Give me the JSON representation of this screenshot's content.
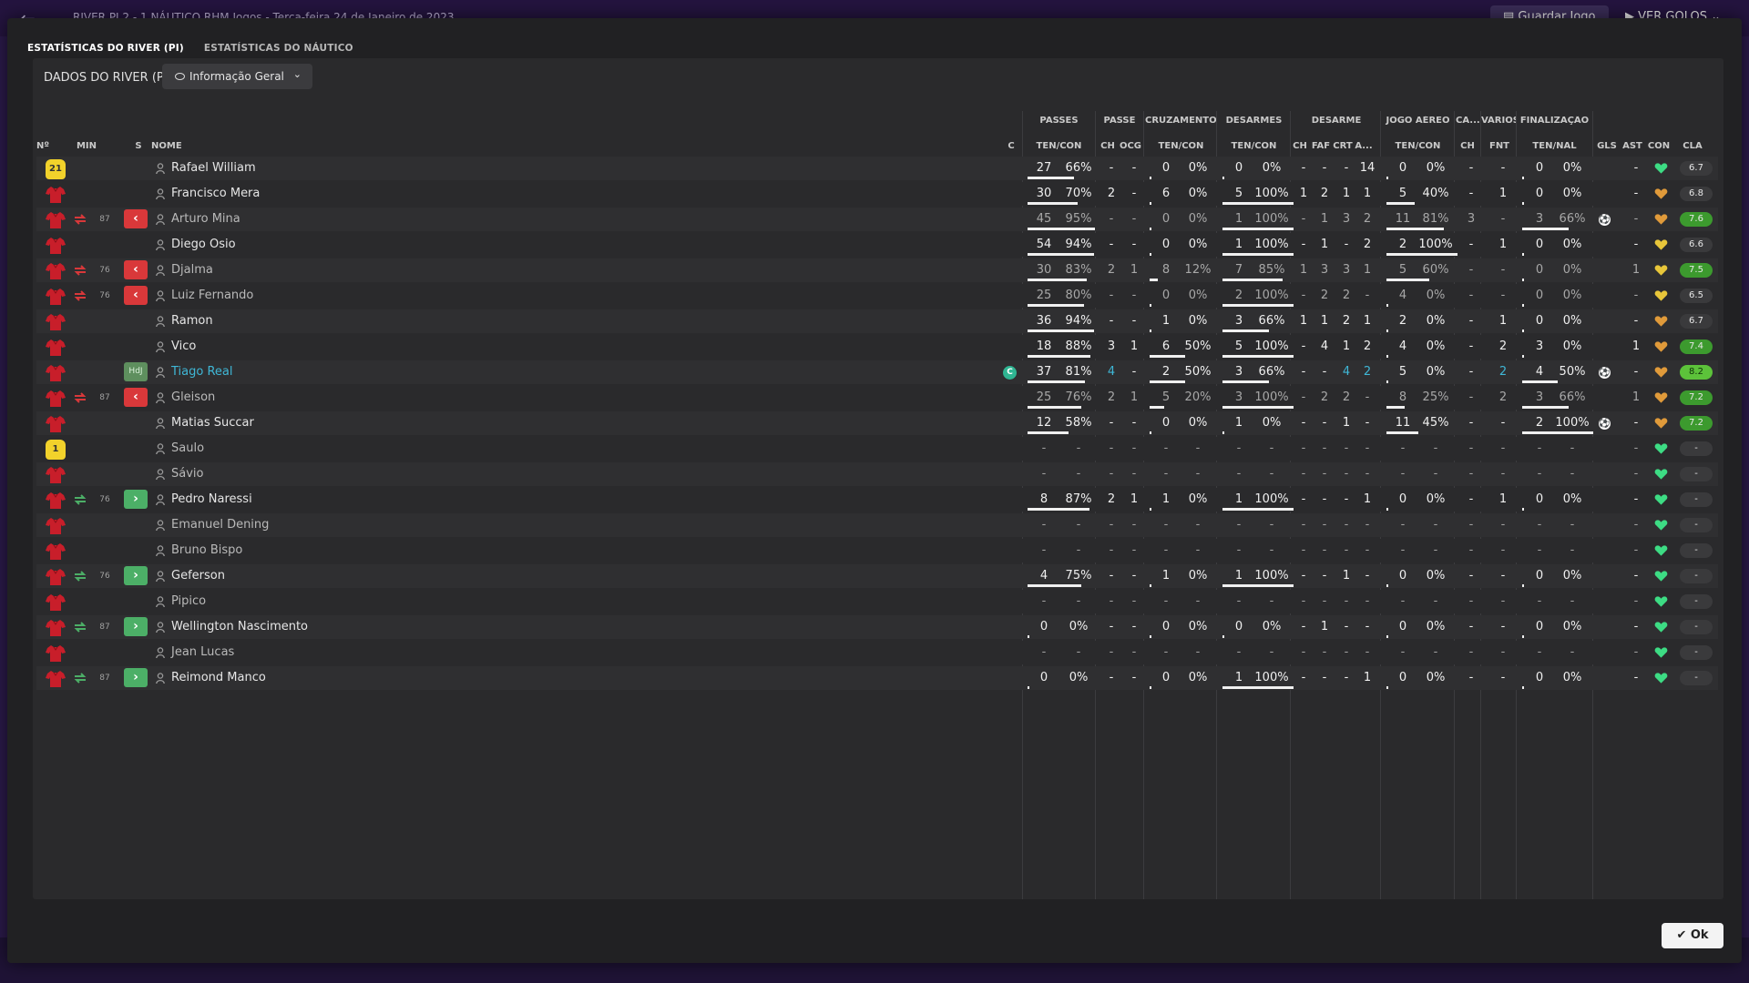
{
  "window": {
    "title": "RIVER PI 2 - 1 NÁUTICO  RHM Jogos  -  Terça-feira 24 de Janeiro de 2023",
    "save_label": "Guardar Jogo",
    "goals_label": "VER GOLOS"
  },
  "tabs": [
    {
      "label": "ESTATÍSTICAS DO RIVER (PI)",
      "active": true
    },
    {
      "label": "ESTATÍSTICAS DO NÁUTICO",
      "active": false
    }
  ],
  "toolbar": {
    "data_label": "DADOS DO RIVER (PI)",
    "view_select": "Informação Geral"
  },
  "groups": [
    "PASSES",
    "PASSE",
    "CRUZAMENTOS",
    "DESARMES",
    "DESARME",
    "JOGO AÉREO",
    "CA...",
    "VÁRIOS",
    "FINALIZAÇÃO"
  ],
  "headers": [
    "Nº",
    "MIN",
    "S",
    "NOME",
    "C",
    "TEN/CON",
    "CH",
    "OCG",
    "TEN/CON",
    "TEN/CON",
    "CH",
    "FAF",
    "CRT",
    "A...",
    "TEN/CON",
    "CH",
    "FNT",
    "TEN/NAL",
    "GLS",
    "AST",
    "CON",
    "CLA"
  ],
  "ok_label": "Ok",
  "colors": {
    "accent_green": "#4caf67",
    "sub_out": "#d9383a",
    "highlight_name": "#3fb7d6",
    "heart_green": "#3ddc84",
    "heart_orange": "#e09a3a",
    "heart_yellow": "#e8c63a"
  },
  "players": [
    {
      "num": "21",
      "shirt": "yellow",
      "sub": "",
      "min": "",
      "name": "Rafael William",
      "dim": false,
      "cap": false,
      "pass_t": "27",
      "pass_p": "66%",
      "pass_f": 0.66,
      "ch": "-",
      "ocg": "-",
      "cr_t": "0",
      "cr_p": "0%",
      "cr_f": 0,
      "ds_t": "0",
      "ds_p": "0%",
      "ds_f": 0,
      "d_ch": "-",
      "faf": "-",
      "crt": "-",
      "a": "14",
      "ae_t": "0",
      "ae_p": "0%",
      "ae_f": 0,
      "ca": "-",
      "fnt": "-",
      "fi_t": "0",
      "fi_p": "0%",
      "fi_f": 0,
      "gls": "",
      "ast": "-",
      "con": "green",
      "cla": "6.7",
      "cla_color": "grey"
    },
    {
      "num": "",
      "shirt": "red",
      "sub": "",
      "min": "",
      "name": "Francisco Mera",
      "dim": false,
      "cap": false,
      "pass_t": "30",
      "pass_p": "70%",
      "pass_f": 0.7,
      "ch": "2",
      "ocg": "-",
      "cr_t": "6",
      "cr_p": "0%",
      "cr_f": 0,
      "ds_t": "5",
      "ds_p": "100%",
      "ds_f": 1,
      "d_ch": "1",
      "faf": "2",
      "crt": "1",
      "a": "1",
      "ae_t": "5",
      "ae_p": "40%",
      "ae_f": 0.4,
      "ca": "-",
      "fnt": "1",
      "fi_t": "0",
      "fi_p": "0%",
      "fi_f": 0,
      "gls": "",
      "ast": "-",
      "con": "orange",
      "cla": "6.8",
      "cla_color": "grey"
    },
    {
      "num": "",
      "shirt": "red",
      "sub": "out",
      "min": "87",
      "name": "Arturo Mina",
      "dim": true,
      "cap": false,
      "pass_t": "45",
      "pass_p": "95%",
      "pass_f": 0.95,
      "ch": "-",
      "ocg": "-",
      "cr_t": "0",
      "cr_p": "0%",
      "cr_f": 0,
      "ds_t": "1",
      "ds_p": "100%",
      "ds_f": 1,
      "d_ch": "-",
      "faf": "1",
      "crt": "3",
      "a": "2",
      "ae_t": "11",
      "ae_p": "81%",
      "ae_f": 0.81,
      "ca": "3",
      "fnt": "-",
      "fi_t": "3",
      "fi_p": "66%",
      "fi_f": 0.66,
      "gls": "goal",
      "ast": "-",
      "con": "orange",
      "cla": "7.6",
      "cla_color": "green"
    },
    {
      "num": "",
      "shirt": "red",
      "sub": "",
      "min": "",
      "name": "Diego Osio",
      "dim": false,
      "cap": false,
      "pass_t": "54",
      "pass_p": "94%",
      "pass_f": 0.94,
      "ch": "-",
      "ocg": "-",
      "cr_t": "0",
      "cr_p": "0%",
      "cr_f": 0,
      "ds_t": "1",
      "ds_p": "100%",
      "ds_f": 1,
      "d_ch": "-",
      "faf": "1",
      "crt": "-",
      "a": "2",
      "ae_t": "2",
      "ae_p": "100%",
      "ae_f": 1,
      "ca": "-",
      "fnt": "1",
      "fi_t": "0",
      "fi_p": "0%",
      "fi_f": 0,
      "gls": "",
      "ast": "-",
      "con": "yellow",
      "cla": "6.6",
      "cla_color": "grey"
    },
    {
      "num": "",
      "shirt": "red",
      "sub": "out",
      "min": "76",
      "name": "Djalma",
      "dim": true,
      "cap": false,
      "pass_t": "30",
      "pass_p": "83%",
      "pass_f": 0.83,
      "ch": "2",
      "ocg": "1",
      "cr_t": "8",
      "cr_p": "12%",
      "cr_f": 0.12,
      "ds_t": "7",
      "ds_p": "85%",
      "ds_f": 0.85,
      "d_ch": "1",
      "faf": "3",
      "crt": "3",
      "a": "1",
      "ae_t": "5",
      "ae_p": "60%",
      "ae_f": 0.6,
      "ca": "-",
      "fnt": "-",
      "fi_t": "0",
      "fi_p": "0%",
      "fi_f": 0,
      "gls": "",
      "ast": "1",
      "con": "yellow",
      "cla": "7.5",
      "cla_color": "green"
    },
    {
      "num": "",
      "shirt": "red",
      "sub": "out",
      "min": "76",
      "name": "Luiz Fernando",
      "dim": true,
      "cap": false,
      "pass_t": "25",
      "pass_p": "80%",
      "pass_f": 0.8,
      "ch": "-",
      "ocg": "-",
      "cr_t": "0",
      "cr_p": "0%",
      "cr_f": 0,
      "ds_t": "2",
      "ds_p": "100%",
      "ds_f": 1,
      "d_ch": "-",
      "faf": "2",
      "crt": "2",
      "a": "-",
      "ae_t": "4",
      "ae_p": "0%",
      "ae_f": 0,
      "ca": "-",
      "fnt": "-",
      "fi_t": "0",
      "fi_p": "0%",
      "fi_f": 0,
      "gls": "",
      "ast": "-",
      "con": "yellow",
      "cla": "6.5",
      "cla_color": "grey"
    },
    {
      "num": "",
      "shirt": "red",
      "sub": "",
      "min": "",
      "name": "Ramon",
      "dim": false,
      "cap": false,
      "pass_t": "36",
      "pass_p": "94%",
      "pass_f": 0.94,
      "ch": "-",
      "ocg": "-",
      "cr_t": "1",
      "cr_p": "0%",
      "cr_f": 0,
      "ds_t": "3",
      "ds_p": "66%",
      "ds_f": 0.66,
      "d_ch": "1",
      "faf": "1",
      "crt": "2",
      "a": "1",
      "ae_t": "2",
      "ae_p": "0%",
      "ae_f": 0,
      "ca": "-",
      "fnt": "1",
      "fi_t": "0",
      "fi_p": "0%",
      "fi_f": 0,
      "gls": "",
      "ast": "-",
      "con": "orange",
      "cla": "6.7",
      "cla_color": "grey"
    },
    {
      "num": "",
      "shirt": "red",
      "sub": "",
      "min": "",
      "name": "Vico",
      "dim": false,
      "cap": false,
      "pass_t": "18",
      "pass_p": "88%",
      "pass_f": 0.88,
      "ch": "3",
      "ocg": "1",
      "cr_t": "6",
      "cr_p": "50%",
      "cr_f": 0.5,
      "ds_t": "5",
      "ds_p": "100%",
      "ds_f": 1,
      "d_ch": "-",
      "faf": "4",
      "crt": "1",
      "a": "2",
      "ae_t": "4",
      "ae_p": "0%",
      "ae_f": 0,
      "ca": "-",
      "fnt": "2",
      "fi_t": "3",
      "fi_p": "0%",
      "fi_f": 0,
      "gls": "",
      "ast": "1",
      "con": "orange",
      "cla": "7.4",
      "cla_color": "green"
    },
    {
      "num": "",
      "shirt": "red",
      "sub": "hdj",
      "min": "",
      "name": "Tiago Real",
      "dim": false,
      "highlight": true,
      "cap": true,
      "pass_t": "37",
      "pass_p": "81%",
      "pass_f": 0.81,
      "ch": "4",
      "ocg": "-",
      "cr_t": "2",
      "cr_p": "50%",
      "cr_f": 0.5,
      "ds_t": "3",
      "ds_p": "66%",
      "ds_f": 0.66,
      "d_ch": "-",
      "faf": "-",
      "crt": "4",
      "a": "2",
      "ae_t": "5",
      "ae_p": "0%",
      "ae_f": 0,
      "ca": "-",
      "fnt": "2",
      "fi_t": "4",
      "fi_p": "50%",
      "fi_f": 0.5,
      "gls": "goal",
      "ast": "-",
      "con": "orange",
      "cla": "8.2",
      "cla_color": "bright"
    },
    {
      "num": "",
      "shirt": "red",
      "sub": "out",
      "min": "87",
      "name": "Gleison",
      "dim": true,
      "cap": false,
      "pass_t": "25",
      "pass_p": "76%",
      "pass_f": 0.76,
      "ch": "2",
      "ocg": "1",
      "cr_t": "5",
      "cr_p": "20%",
      "cr_f": 0.2,
      "ds_t": "3",
      "ds_p": "100%",
      "ds_f": 1,
      "d_ch": "-",
      "faf": "2",
      "crt": "2",
      "a": "-",
      "ae_t": "8",
      "ae_p": "25%",
      "ae_f": 0.25,
      "ca": "-",
      "fnt": "2",
      "fi_t": "3",
      "fi_p": "66%",
      "fi_f": 0.66,
      "gls": "",
      "ast": "1",
      "con": "orange",
      "cla": "7.2",
      "cla_color": "green"
    },
    {
      "num": "",
      "shirt": "red",
      "sub": "",
      "min": "",
      "name": "Matias Succar",
      "dim": false,
      "cap": false,
      "pass_t": "12",
      "pass_p": "58%",
      "pass_f": 0.58,
      "ch": "-",
      "ocg": "-",
      "cr_t": "0",
      "cr_p": "0%",
      "cr_f": 0,
      "ds_t": "1",
      "ds_p": "0%",
      "ds_f": 0,
      "d_ch": "-",
      "faf": "-",
      "crt": "1",
      "a": "-",
      "ae_t": "11",
      "ae_p": "45%",
      "ae_f": 0.45,
      "ca": "-",
      "fnt": "-",
      "fi_t": "2",
      "fi_p": "100%",
      "fi_f": 1,
      "gls": "goal",
      "ast": "-",
      "con": "orange",
      "cla": "7.2",
      "cla_color": "green"
    },
    {
      "num": "1",
      "shirt": "yellow",
      "sub": "",
      "min": "",
      "name": "Saulo",
      "dim": true,
      "cap": false,
      "empty": true,
      "con": "green",
      "cla": "-",
      "cla_color": "grey"
    },
    {
      "num": "",
      "shirt": "red",
      "sub": "",
      "min": "",
      "name": "Sávio",
      "dim": true,
      "cap": false,
      "empty": true,
      "con": "green",
      "cla": "-",
      "cla_color": "grey"
    },
    {
      "num": "",
      "shirt": "red",
      "sub": "in",
      "min": "76",
      "name": "Pedro Naressi",
      "dim": false,
      "cap": false,
      "pass_t": "8",
      "pass_p": "87%",
      "pass_f": 0.87,
      "ch": "2",
      "ocg": "1",
      "cr_t": "1",
      "cr_p": "0%",
      "cr_f": 0,
      "ds_t": "1",
      "ds_p": "100%",
      "ds_f": 1,
      "d_ch": "-",
      "faf": "-",
      "crt": "-",
      "a": "1",
      "ae_t": "0",
      "ae_p": "0%",
      "ae_f": 0,
      "ca": "-",
      "fnt": "1",
      "fi_t": "0",
      "fi_p": "0%",
      "fi_f": 0,
      "gls": "",
      "ast": "-",
      "con": "green",
      "cla": "-",
      "cla_color": "grey"
    },
    {
      "num": "",
      "shirt": "red",
      "sub": "",
      "min": "",
      "name": "Emanuel Dening",
      "dim": true,
      "cap": false,
      "empty": true,
      "con": "green",
      "cla": "-",
      "cla_color": "grey"
    },
    {
      "num": "",
      "shirt": "red",
      "sub": "",
      "min": "",
      "name": "Bruno Bispo",
      "dim": true,
      "cap": false,
      "empty": true,
      "con": "green",
      "cla": "-",
      "cla_color": "grey"
    },
    {
      "num": "",
      "shirt": "red",
      "sub": "in",
      "min": "76",
      "name": "Geferson",
      "dim": false,
      "cap": false,
      "pass_t": "4",
      "pass_p": "75%",
      "pass_f": 0.75,
      "ch": "-",
      "ocg": "-",
      "cr_t": "1",
      "cr_p": "0%",
      "cr_f": 0,
      "ds_t": "1",
      "ds_p": "100%",
      "ds_f": 1,
      "d_ch": "-",
      "faf": "-",
      "crt": "1",
      "a": "-",
      "ae_t": "0",
      "ae_p": "0%",
      "ae_f": 0,
      "ca": "-",
      "fnt": "-",
      "fi_t": "0",
      "fi_p": "0%",
      "fi_f": 0,
      "gls": "",
      "ast": "-",
      "con": "green",
      "cla": "-",
      "cla_color": "grey"
    },
    {
      "num": "",
      "shirt": "red",
      "sub": "",
      "min": "",
      "name": "Pipico",
      "dim": true,
      "cap": false,
      "empty": true,
      "con": "green",
      "cla": "-",
      "cla_color": "grey"
    },
    {
      "num": "",
      "shirt": "red",
      "sub": "in",
      "min": "87",
      "name": "Wellington Nascimento",
      "dim": false,
      "cap": false,
      "pass_t": "0",
      "pass_p": "0%",
      "pass_f": 0,
      "ch": "-",
      "ocg": "-",
      "cr_t": "0",
      "cr_p": "0%",
      "cr_f": 0,
      "ds_t": "0",
      "ds_p": "0%",
      "ds_f": 0,
      "d_ch": "-",
      "faf": "1",
      "crt": "-",
      "a": "-",
      "ae_t": "0",
      "ae_p": "0%",
      "ae_f": 0,
      "ca": "-",
      "fnt": "-",
      "fi_t": "0",
      "fi_p": "0%",
      "fi_f": 0,
      "gls": "",
      "ast": "-",
      "con": "green",
      "cla": "-",
      "cla_color": "grey"
    },
    {
      "num": "",
      "shirt": "red",
      "sub": "",
      "min": "",
      "name": "Jean Lucas",
      "dim": true,
      "cap": false,
      "empty": true,
      "con": "green",
      "cla": "-",
      "cla_color": "grey"
    },
    {
      "num": "",
      "shirt": "red",
      "sub": "in",
      "min": "87",
      "name": "Reimond Manco",
      "dim": false,
      "cap": false,
      "pass_t": "0",
      "pass_p": "0%",
      "pass_f": 0,
      "ch": "-",
      "ocg": "-",
      "cr_t": "0",
      "cr_p": "0%",
      "cr_f": 0,
      "ds_t": "1",
      "ds_p": "100%",
      "ds_f": 1,
      "d_ch": "-",
      "faf": "-",
      "crt": "-",
      "a": "1",
      "ae_t": "0",
      "ae_p": "0%",
      "ae_f": 0,
      "ca": "-",
      "fnt": "-",
      "fi_t": "0",
      "fi_p": "0%",
      "fi_f": 0,
      "gls": "",
      "ast": "-",
      "con": "green",
      "cla": "-",
      "cla_color": "grey"
    }
  ]
}
